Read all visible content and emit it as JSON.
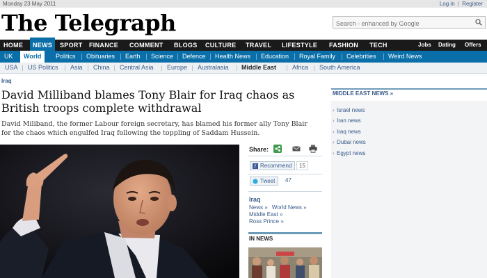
{
  "topbar": {
    "date": "Monday 23 May 2011",
    "login": "Log in",
    "separator": "|",
    "register": "Register"
  },
  "masthead": {
    "logo": "The Telegraph"
  },
  "search": {
    "placeholder": "Search - enhanced by Google"
  },
  "main_nav": {
    "items": [
      "HOME",
      "NEWS",
      "SPORT",
      "FINANCE",
      "COMMENT",
      "BLOGS",
      "CULTURE",
      "TRAVEL",
      "LIFESTYLE",
      "FASHION",
      "TECH"
    ],
    "active": "NEWS",
    "right": [
      "Jobs",
      "Dating",
      "Offers"
    ]
  },
  "section_nav": {
    "items": [
      "UK",
      "World",
      "Politics",
      "Obituaries",
      "Earth",
      "Science",
      "Defence",
      "Health News",
      "Education",
      "Royal Family",
      "Celebrities",
      "Weird News"
    ],
    "active": "World"
  },
  "sub_nav": {
    "items": [
      "USA",
      "US Politics",
      "Asia",
      "China",
      "Central Asia",
      "Europe",
      "Australasia",
      "Middle East",
      "Africa",
      "South America"
    ],
    "active": "Middle East"
  },
  "article": {
    "breadcrumb": "Iraq",
    "headline": "David Milliband blames Tony Blair for Iraq chaos as British troops complete withdrawal",
    "standfirst": "David Miliband, the former Labour foreign secretary, has blamed his former ally Tony Blair for the chaos which engulfed Iraq following the toppling of Saddam Hussein."
  },
  "share": {
    "label": "Share:",
    "recommend_label": "Recommend",
    "recommend_count": "15",
    "tweet_label": "Tweet",
    "tweet_count": "47"
  },
  "related": {
    "title": "Iraq",
    "links": [
      "News »",
      "World News »",
      "Middle East »",
      "Ross Prince »"
    ]
  },
  "in_news": {
    "title": "IN NEWS"
  },
  "sidebar": {
    "title": "MIDDLE EAST NEWS »",
    "links": [
      "Israel news",
      "Iran news",
      "Iraq news",
      "Dubai news",
      "Egypt news"
    ]
  },
  "colors": {
    "brand_blue": "#0a6fa8",
    "nav_black": "#1a1a1a",
    "link_blue": "#3a5b8a"
  }
}
